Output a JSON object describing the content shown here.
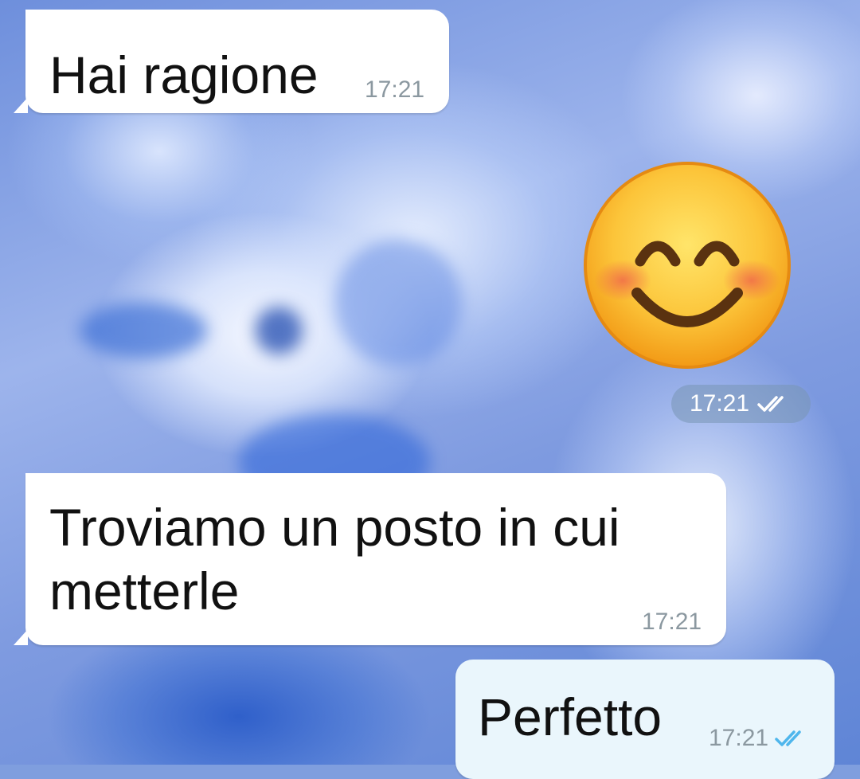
{
  "messages": [
    {
      "text": "Hai ragione",
      "time": "17:21"
    },
    {
      "type": "emoji",
      "emoji": "smiling-face-with-smiling-eyes-icon",
      "time": "17:21"
    },
    {
      "text": "Troviamo un posto in cui metterle",
      "time": "17:21"
    },
    {
      "text": "Perfetto",
      "time": "17:21"
    }
  ],
  "colors": {
    "incoming_bubble": "#ffffff",
    "outgoing_bubble": "#eaf6fc",
    "timestamp": "#8b98a0",
    "read_ticks": "#4fb6ec"
  }
}
